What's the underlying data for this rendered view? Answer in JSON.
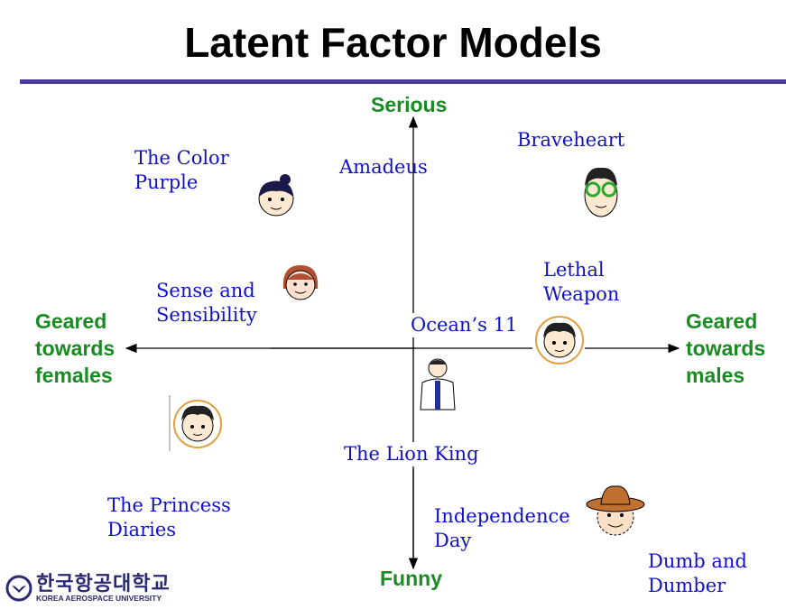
{
  "title": "Latent Factor Models",
  "axes": {
    "top": "Serious",
    "bottom": "Funny",
    "left": "Geared\ntowards\nfemales",
    "right": "Geared\ntowards\nmales"
  },
  "movies": {
    "color_purple": "The Color\nPurple",
    "amadeus": "Amadeus",
    "braveheart": "Braveheart",
    "sense": "Sense and\nSensibility",
    "lethal": "Lethal\nWeapon",
    "oceans": "Ocean’s 11",
    "lion": "The Lion King",
    "princess": "The Princess\nDiaries",
    "independence": "Independence\nDay",
    "dumb": "Dumb and\nDumber"
  },
  "logo": {
    "korean": "한국항공대학교",
    "english": "KOREA AEROSPACE UNIVERSITY"
  },
  "colors": {
    "title_rule": "#4b3b9b",
    "movie_text": "#1010c8",
    "axis_text": "#1a8a22"
  }
}
